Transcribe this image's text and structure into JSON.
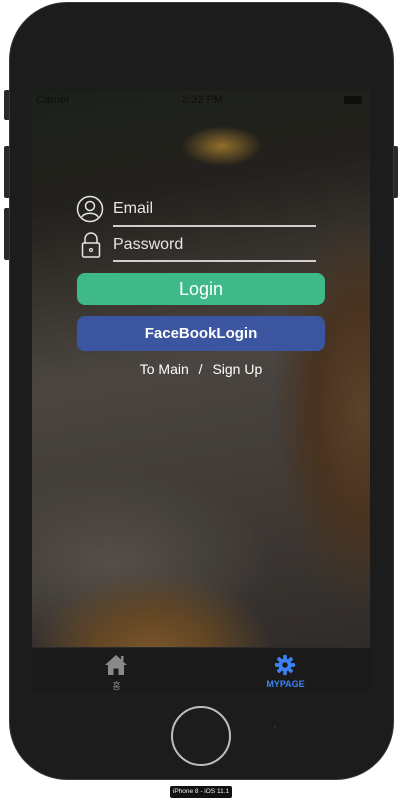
{
  "status_bar": {
    "carrier": "Carrier",
    "time": "2:32 PM"
  },
  "login": {
    "email_placeholder": "Email",
    "password_placeholder": "Password",
    "login_label": "Login",
    "facebook_label": "FaceBookLogin",
    "to_main_label": "To Main",
    "separator": "/",
    "signup_label": "Sign Up"
  },
  "tabbar": {
    "tabs": [
      {
        "label": "홈",
        "icon": "house-icon",
        "active": false
      },
      {
        "label": "MYPAGE",
        "icon": "gear-icon",
        "active": true
      }
    ],
    "active_color": "#3b82f6"
  },
  "device": {
    "label": "iPhone 8 - iOS 11.1"
  },
  "colors": {
    "login_button": "#3fb98a",
    "facebook_button": "#3c55a0"
  }
}
